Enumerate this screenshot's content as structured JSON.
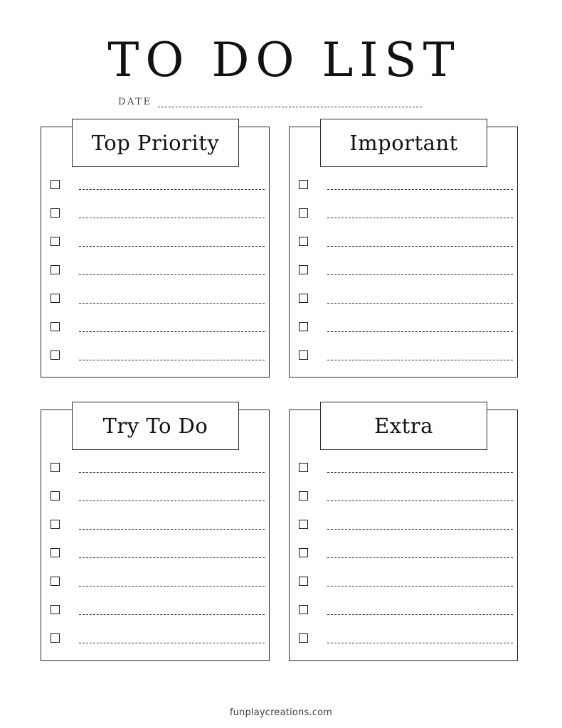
{
  "document": {
    "title": "TO DO LIST",
    "date_label": "DATE",
    "date_value": "",
    "footer": "funplaycreations.com",
    "ink_color": "#111111",
    "line_color": "#333333",
    "background": "#ffffff"
  },
  "sections": [
    {
      "id": "top-priority",
      "heading": "Top Priority",
      "items": [
        "",
        "",
        "",
        "",
        "",
        "",
        ""
      ]
    },
    {
      "id": "important",
      "heading": "Important",
      "items": [
        "",
        "",
        "",
        "",
        "",
        "",
        ""
      ]
    },
    {
      "id": "try-to-do",
      "heading": "Try To Do",
      "items": [
        "",
        "",
        "",
        "",
        "",
        "",
        ""
      ]
    },
    {
      "id": "extra",
      "heading": "Extra",
      "items": [
        "",
        "",
        "",
        "",
        "",
        "",
        ""
      ]
    }
  ]
}
